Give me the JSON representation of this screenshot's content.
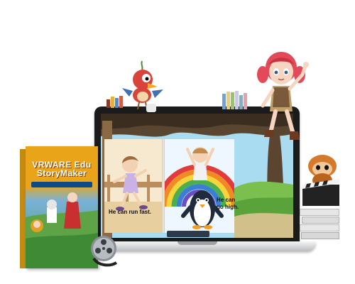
{
  "screen": {
    "caption_left": "He can run fast.",
    "caption_right_line1": "He can",
    "caption_right_line2": "go high."
  },
  "product_box": {
    "title_line1": "VRWARE Edu",
    "title_line2": "StoryMaker"
  },
  "colors": {
    "laptop_bezel": "#1b1b1b",
    "box_orange": "#d79a12",
    "sky": "#9fd3ec",
    "grass": "#6fb24a"
  }
}
